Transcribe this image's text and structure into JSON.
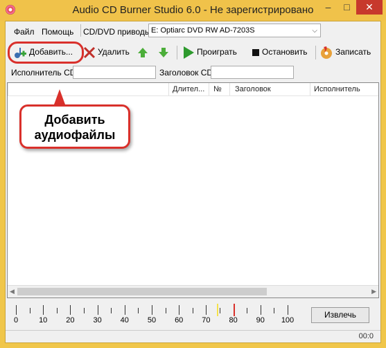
{
  "window": {
    "title": "Audio CD Burner Studio 6.0 - Не зарегистрировано",
    "min": "–",
    "max": "□",
    "close": "✕"
  },
  "menu": {
    "file": "Файл",
    "help": "Помощь"
  },
  "drive": {
    "label": "CD/DVD приводы",
    "value": "E: Optiarc DVD RW AD-7203S"
  },
  "toolbar": {
    "add": "Добавить...",
    "remove": "Удалить",
    "play": "Проиграть",
    "stop": "Остановить",
    "burn": "Записать"
  },
  "cd": {
    "artist_label": "Исполнитель CD",
    "title_label": "Заголовок CD",
    "artist_value": "",
    "title_value": ""
  },
  "list": {
    "columns": [
      "Длител...",
      "№",
      "Заголовок",
      "Исполнитель"
    ]
  },
  "callout": {
    "line1": "Добавить",
    "line2": "аудиофайлы"
  },
  "scale": {
    "labels": [
      "0",
      "10",
      "20",
      "30",
      "40",
      "50",
      "60",
      "70",
      "80",
      "90",
      "100"
    ],
    "yellow_marker": 74,
    "red_marker": 80
  },
  "eject": "Извлечь",
  "status": {
    "time": "00:0"
  },
  "colors": {
    "frame": "#f0c24a",
    "accent": "#d9302b",
    "yellow": "#f5e24a"
  }
}
